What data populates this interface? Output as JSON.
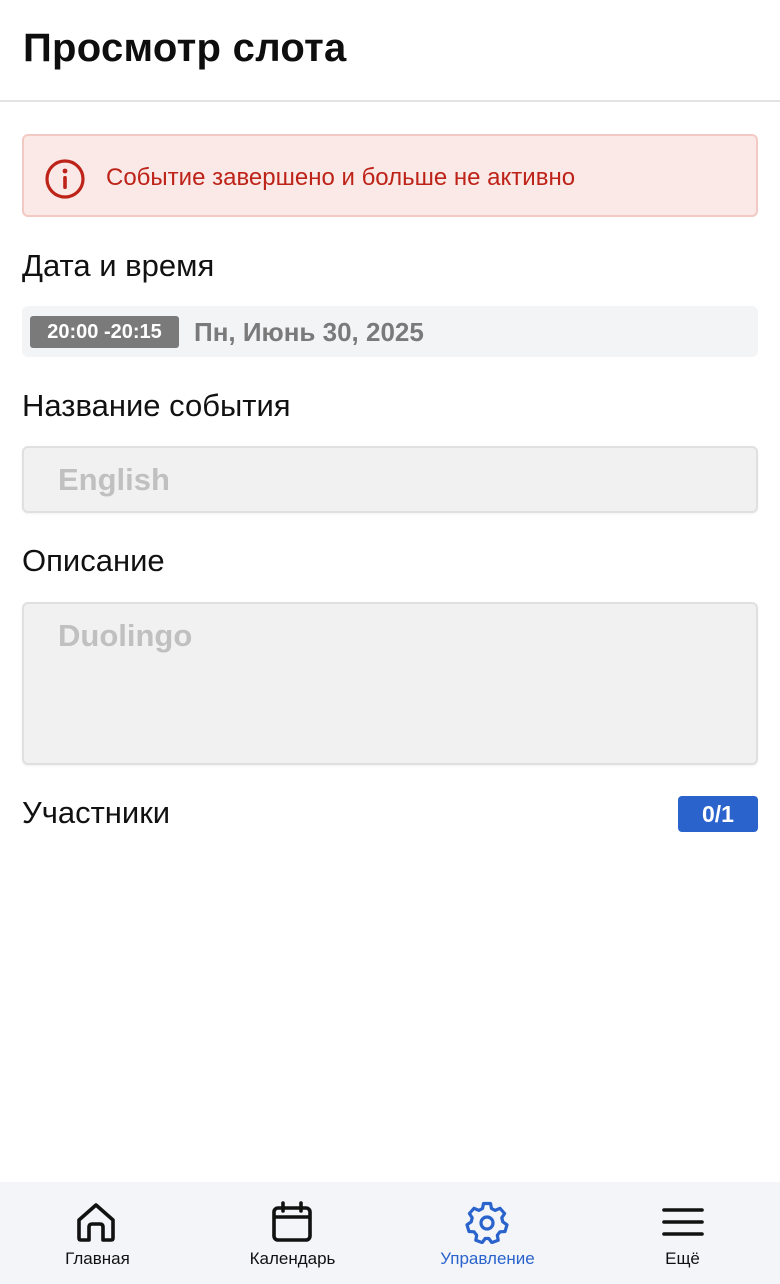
{
  "header": {
    "title": "Просмотр слота"
  },
  "alert": {
    "message": "Событие завершено и больше не активно",
    "icon": "alert-circle-icon",
    "color": "#bd2318"
  },
  "datetime": {
    "label": "Дата и время",
    "time_range": "20:00 -20:15",
    "date": "Пн, Июнь 30, 2025"
  },
  "event_name": {
    "label": "Название события",
    "value": "English"
  },
  "description": {
    "label": "Описание",
    "value": "Duolingo"
  },
  "participants": {
    "label": "Участники",
    "count": "0/1"
  },
  "bottom_nav": {
    "accent": "#2a63cc",
    "items": [
      {
        "label": "Главная",
        "icon": "home-icon",
        "active": false
      },
      {
        "label": "Календарь",
        "icon": "calendar-icon",
        "active": false
      },
      {
        "label": "Управление",
        "icon": "gear-icon",
        "active": true
      },
      {
        "label": "Ещё",
        "icon": "menu-icon",
        "active": false
      }
    ]
  }
}
